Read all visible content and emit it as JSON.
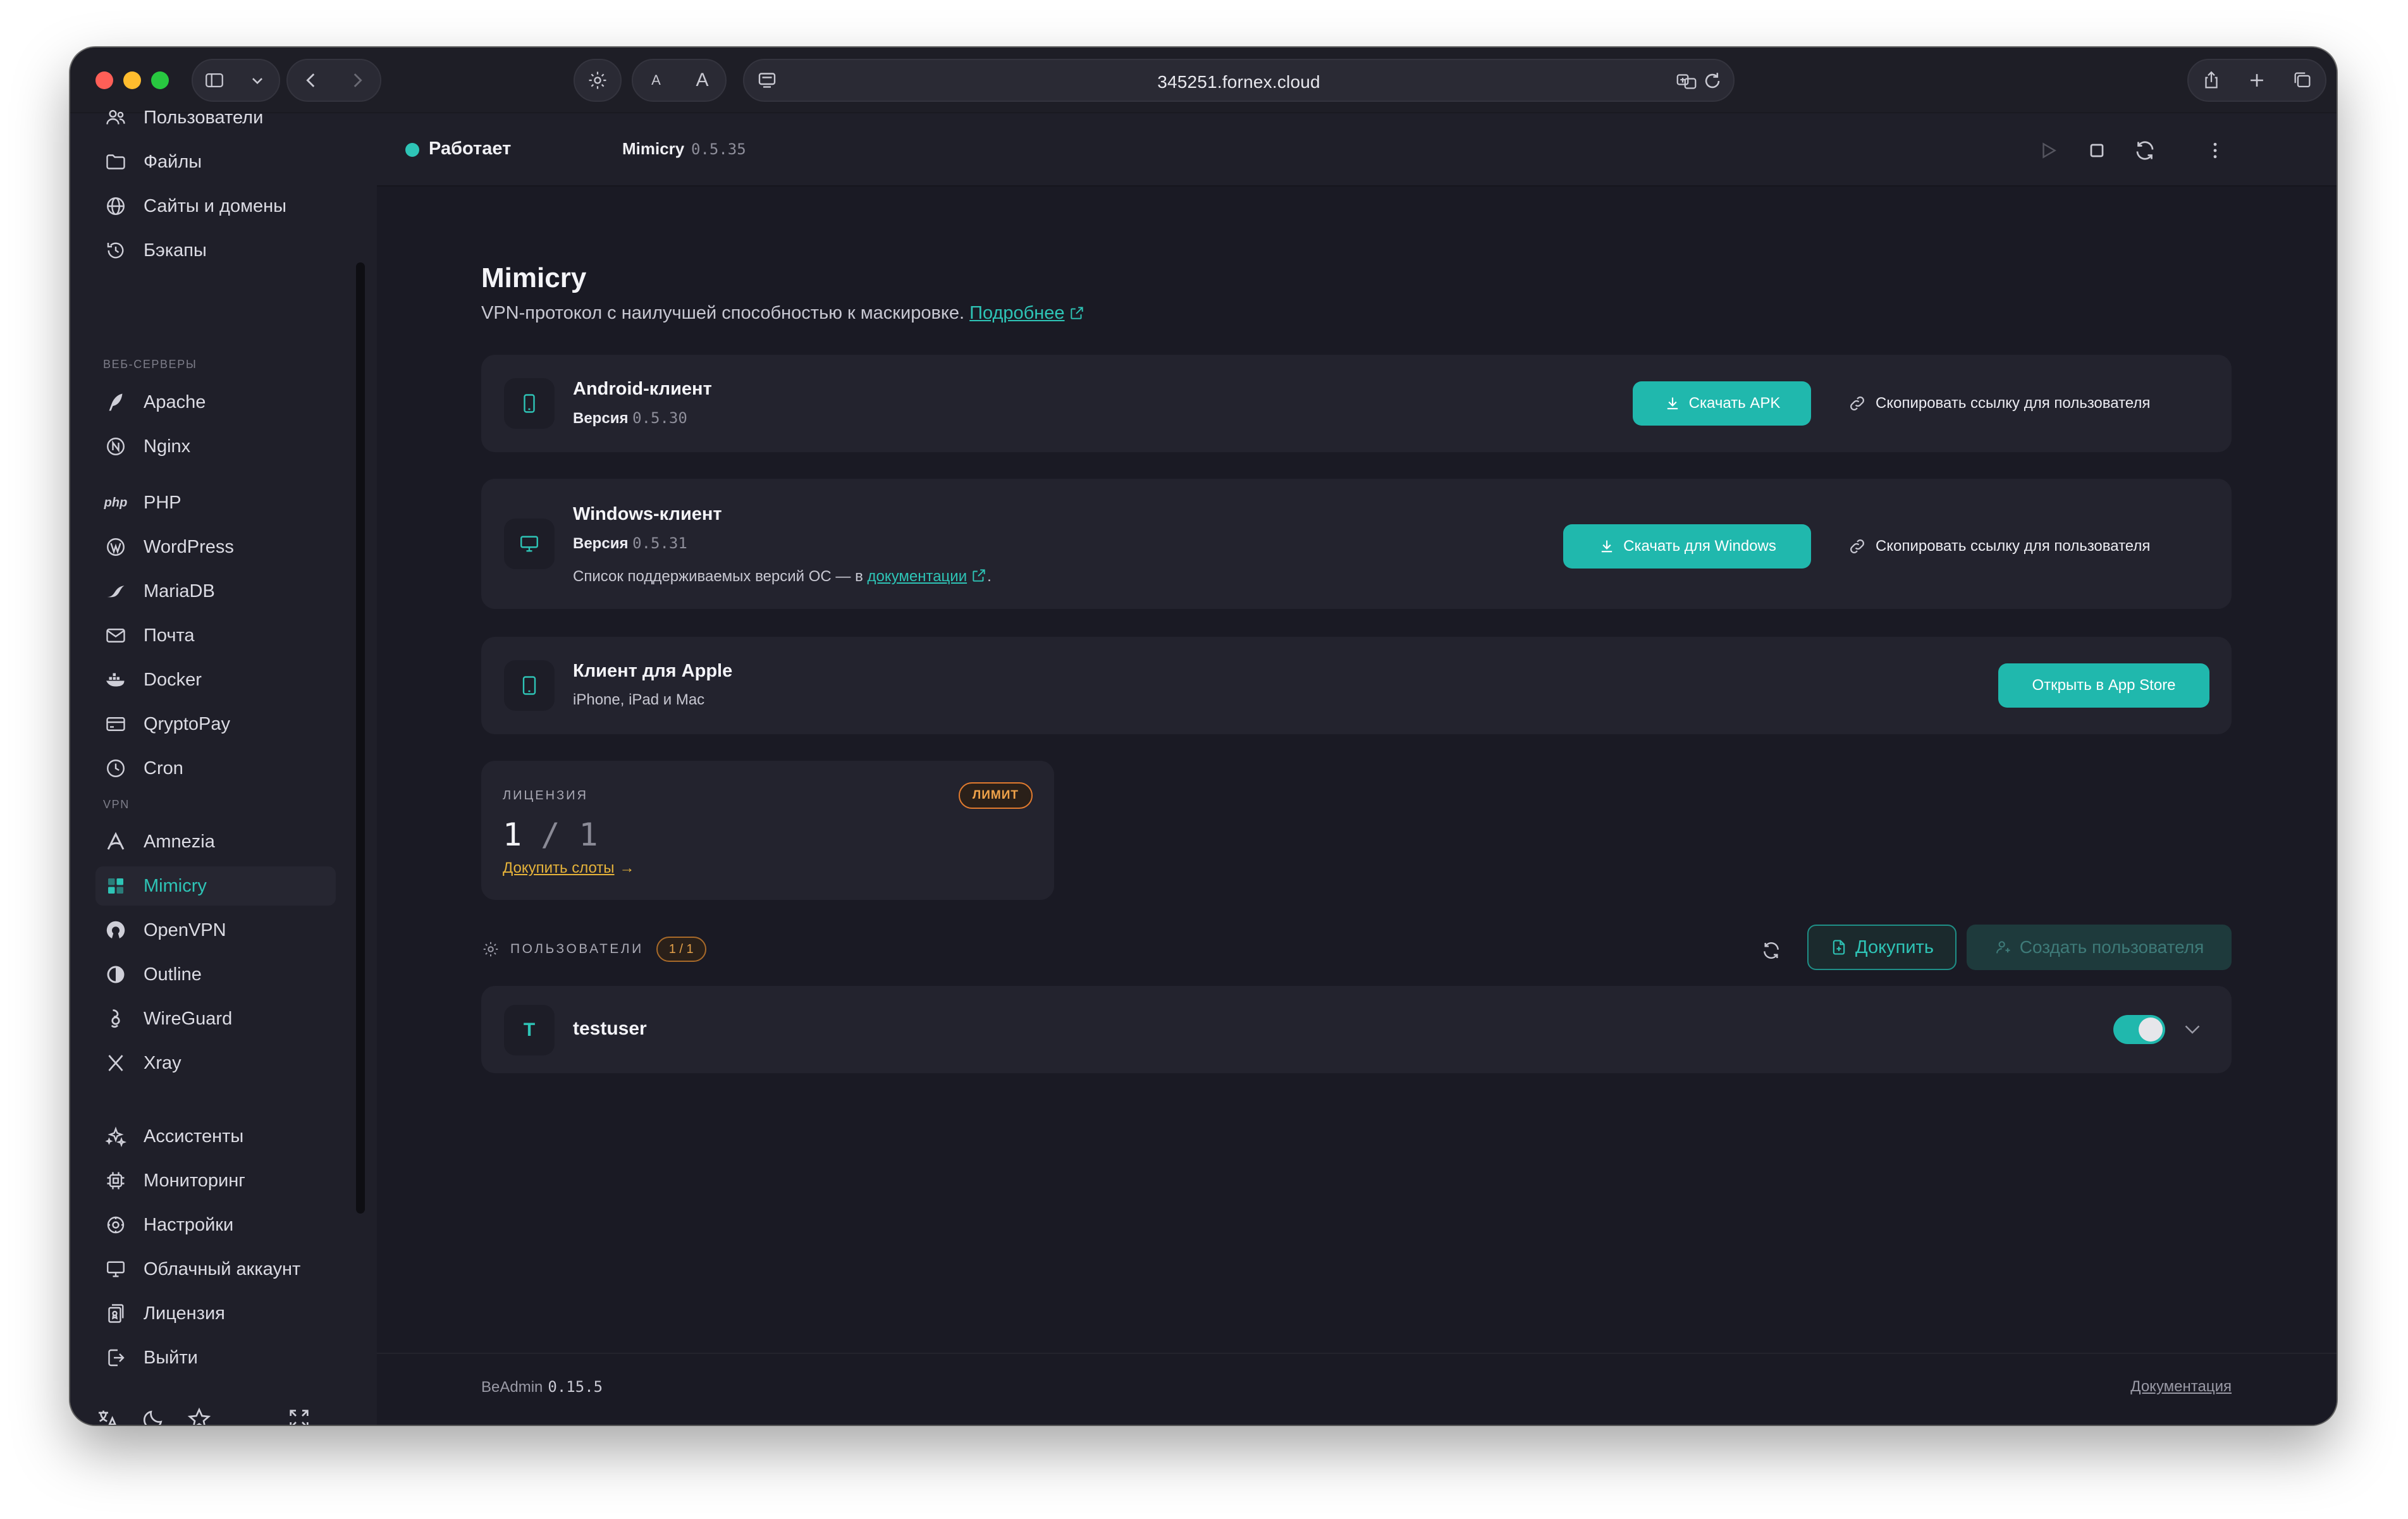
{
  "browser": {
    "url": "345251.fornex.cloud",
    "text_size_small": "A",
    "text_size_large": "A"
  },
  "sidebar": {
    "items_top": [
      {
        "label": "Пользователи",
        "icon": "users-icon"
      },
      {
        "label": "Файлы",
        "icon": "folder-icon"
      },
      {
        "label": "Сайты и домены",
        "icon": "globe-icon"
      },
      {
        "label": "Бэкапы",
        "icon": "history-icon"
      }
    ],
    "section_web": "ВЕБ-СЕРВЕРЫ",
    "items_web": [
      {
        "label": "Apache",
        "icon": "feather-icon"
      },
      {
        "label": "Nginx",
        "icon": "nginx-icon"
      }
    ],
    "items_apps": [
      {
        "label": "PHP",
        "icon": "php-icon",
        "icon_text": "php"
      },
      {
        "label": "WordPress",
        "icon": "wordpress-icon"
      },
      {
        "label": "MariaDB",
        "icon": "mariadb-icon"
      },
      {
        "label": "Почта",
        "icon": "mail-icon"
      },
      {
        "label": "Docker",
        "icon": "docker-icon"
      },
      {
        "label": "QryptoPay",
        "icon": "card-icon"
      },
      {
        "label": "Cron",
        "icon": "clock-icon"
      }
    ],
    "section_vpn": "VPN",
    "items_vpn": [
      {
        "label": "Amnezia",
        "icon": "amnezia-icon"
      },
      {
        "label": "Mimicry",
        "icon": "mimicry-icon",
        "active": true
      },
      {
        "label": "OpenVPN",
        "icon": "openvpn-icon"
      },
      {
        "label": "Outline",
        "icon": "outline-icon"
      },
      {
        "label": "WireGuard",
        "icon": "wireguard-icon"
      },
      {
        "label": "Xray",
        "icon": "xray-icon"
      }
    ],
    "items_bottom": [
      {
        "label": "Ассистенты",
        "icon": "sparkles-icon"
      },
      {
        "label": "Мониторинг",
        "icon": "cpu-icon"
      },
      {
        "label": "Настройки",
        "icon": "gear-icon"
      },
      {
        "label": "Облачный аккаунт",
        "icon": "monitor-icon"
      },
      {
        "label": "Лицензия",
        "icon": "license-icon"
      },
      {
        "label": "Выйти",
        "icon": "logout-icon"
      }
    ],
    "accent": "#2ec4b6"
  },
  "topbar": {
    "status": "Работает",
    "status_color": "#2ec4b6",
    "app_name": "Mimicry",
    "app_version": "0.5.35"
  },
  "page": {
    "title": "Mimicry",
    "subtitle": "VPN-протокол с наилучшей способностью к маскировке.",
    "more_link": "Подробнее"
  },
  "clients": {
    "android": {
      "title": "Android-клиент",
      "version_label": "Версия",
      "version": "0.5.30",
      "download_label": "Скачать APK",
      "copy_label": "Скопировать ссылку для пользователя"
    },
    "windows": {
      "title": "Windows-клиент",
      "version_label": "Версия",
      "version": "0.5.31",
      "note_prefix": "Список поддерживаемых версий ОС — в",
      "note_link": "документации",
      "note_suffix": ".",
      "download_label": "Скачать для Windows",
      "copy_label": "Скопировать ссылку для пользователя"
    },
    "apple": {
      "title": "Клиент для Apple",
      "platforms": "iPhone, iPad и Mac",
      "open_label": "Открыть в App Store"
    }
  },
  "license": {
    "label": "ЛИЦЕНЗИЯ",
    "badge": "ЛИМИТ",
    "used": "1",
    "separator": "/",
    "total": "1",
    "buy_link": "Докупить слоты",
    "buy_arrow": "→"
  },
  "users": {
    "label": "ПОЛЬЗОВАТЕЛИ",
    "badge": "1 / 1",
    "buy_label": "Докупить",
    "create_label": "Создать пользователя",
    "list": [
      {
        "initial": "T",
        "name": "testuser",
        "enabled": true
      }
    ]
  },
  "footer": {
    "product": "BeAdmin",
    "version": "0.15.5",
    "docs_link": "Документация"
  }
}
